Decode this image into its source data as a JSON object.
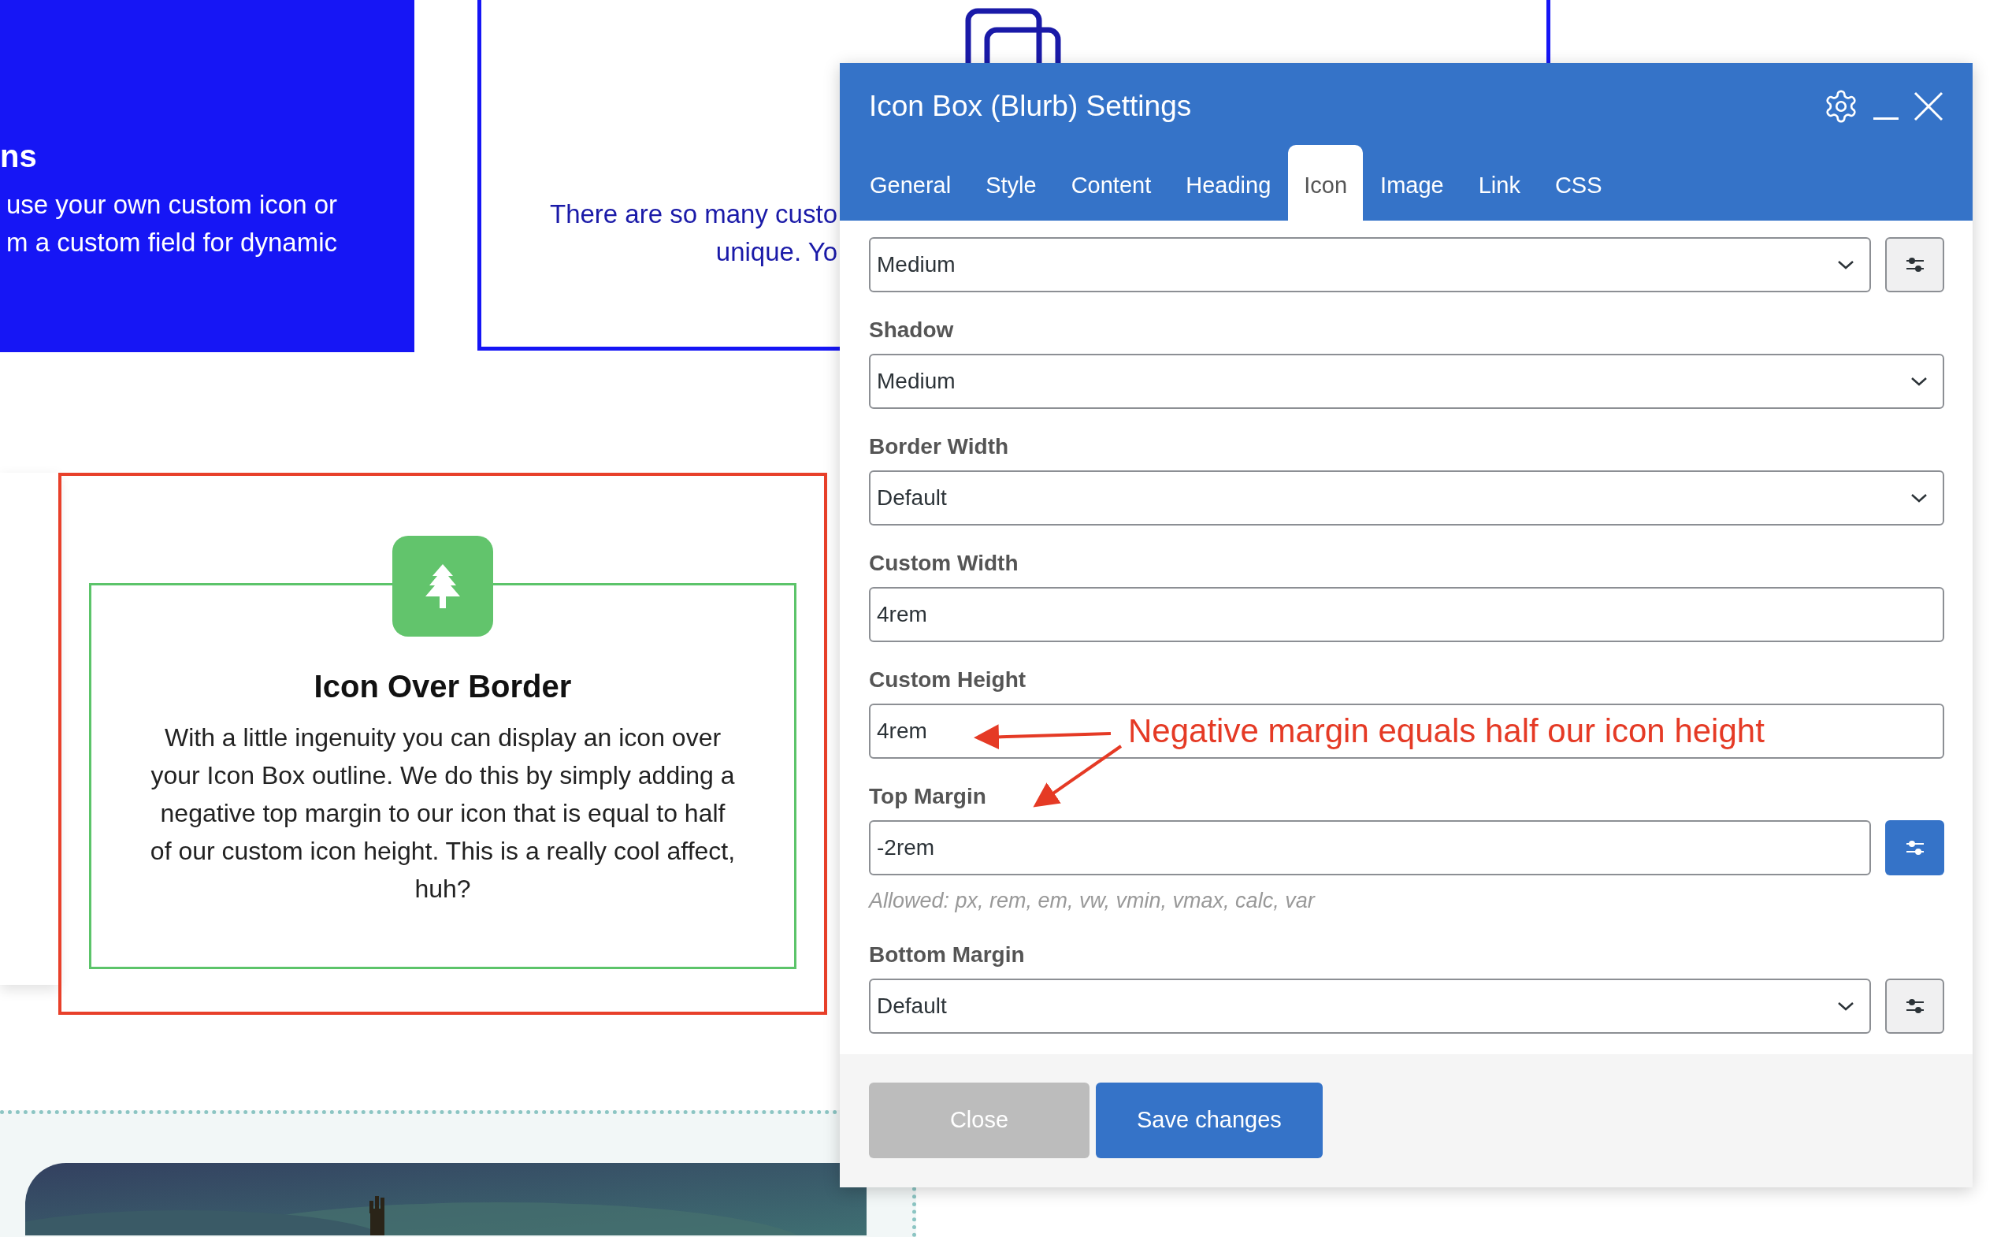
{
  "page": {
    "filled_card": {
      "heading": "ns",
      "lines": [
        "use your own custom icon or",
        "m a custom field for dynamic"
      ]
    },
    "outlined_card": {
      "lines": [
        "There are so many custo",
        "unique. Yo"
      ]
    },
    "icon_box": {
      "heading": "Icon Over Border",
      "text": "With a little ingenuity you can display an icon over your Icon Box outline. We do this by simply adding a negative top margin to our icon that is equal to half of our custom icon height. This is a really cool affect, huh?"
    }
  },
  "dialog": {
    "title": "Icon Box (Blurb) Settings",
    "tabs": [
      {
        "label": "General",
        "selected": false
      },
      {
        "label": "Style",
        "selected": false
      },
      {
        "label": "Content",
        "selected": false
      },
      {
        "label": "Heading",
        "selected": false
      },
      {
        "label": "Icon",
        "selected": true
      },
      {
        "label": "Image",
        "selected": false
      },
      {
        "label": "Link",
        "selected": false
      },
      {
        "label": "CSS",
        "selected": false
      }
    ],
    "fields": [
      {
        "kind": "select",
        "value": "Medium",
        "adjust_button": {
          "selected": false
        }
      },
      {
        "kind": "select",
        "label": "Shadow",
        "value": "Medium"
      },
      {
        "kind": "select",
        "label": "Border Width",
        "value": "Default"
      },
      {
        "kind": "input",
        "label": "Custom Width",
        "value": "4rem"
      },
      {
        "kind": "input",
        "label": "Custom Height",
        "value": "4rem"
      },
      {
        "kind": "input",
        "label": "Top Margin",
        "value": "-2rem",
        "adjust_button": {
          "selected": true
        },
        "hint": "Allowed: px, rem, em, vw, vmin, vmax, calc, var"
      },
      {
        "kind": "select",
        "label": "Bottom Margin",
        "value": "Default",
        "adjust_button": {
          "selected": false
        }
      }
    ],
    "buttons": [
      {
        "label": "Close",
        "kind": "secondary"
      },
      {
        "label": "Save changes",
        "kind": "primary"
      }
    ],
    "annotation": "Negative margin equals half our icon height"
  }
}
